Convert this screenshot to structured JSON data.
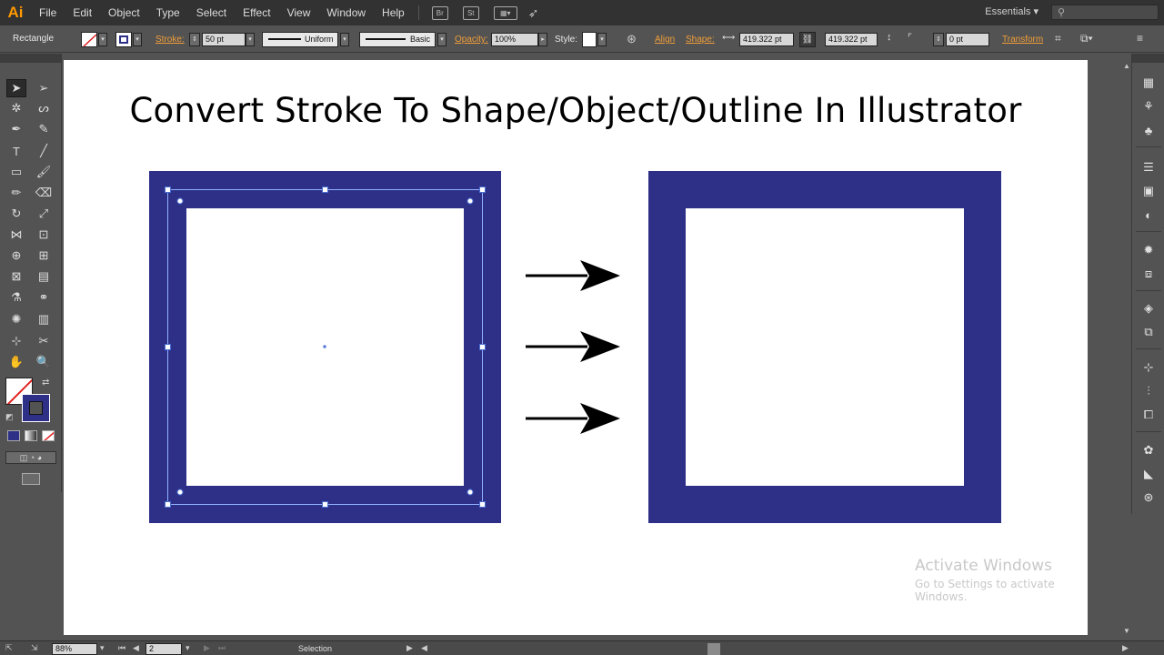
{
  "app": {
    "logo": "Ai",
    "workspace": "Essentials"
  },
  "menu": [
    "File",
    "Edit",
    "Object",
    "Type",
    "Select",
    "Effect",
    "View",
    "Window",
    "Help"
  ],
  "menubar_icons": {
    "bridge": "Br",
    "stock": "St"
  },
  "control": {
    "tool_name": "Rectangle",
    "stroke_label": "Stroke:",
    "stroke_weight": "50 pt",
    "profile": "Uniform",
    "brush": "Basic",
    "opacity_label": "Opacity:",
    "opacity": "100%",
    "style_label": "Style:",
    "align_label": "Align",
    "shape_label": "Shape:",
    "width": "419.322 pt",
    "height": "419.322 pt",
    "corner": "0 pt",
    "transform_label": "Transform"
  },
  "artboard": {
    "title": "Convert Stroke To Shape/Object/Outline In Illustrator",
    "watermark_title": "Activate Windows",
    "watermark_sub": "Go to Settings to activate Windows."
  },
  "status": {
    "zoom": "88%",
    "artboard_num": "2",
    "tool": "Selection"
  },
  "colors": {
    "stroke_blue": "#2e3088",
    "ui_dark": "#323232",
    "ui_mid": "#535353",
    "accent_orange": "#f09e3a"
  }
}
